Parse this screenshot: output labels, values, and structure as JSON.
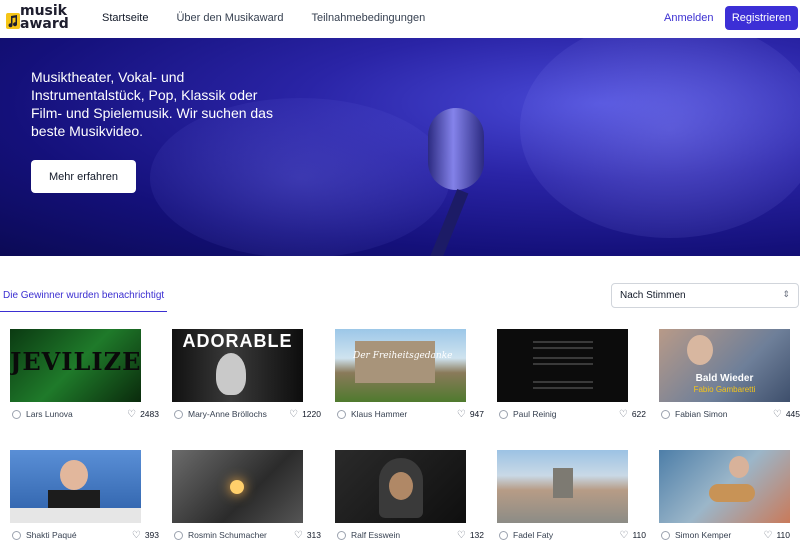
{
  "header": {
    "logo": [
      "musik",
      "award"
    ],
    "nav": [
      "Startseite",
      "Über den Musikaward",
      "Teilnahmebedingungen"
    ],
    "login_label": "Anmelden",
    "register_label": "Registrieren"
  },
  "hero": {
    "text": "Musiktheater, Vokal- und Instrumentalstück, Pop, Klassik oder Film- und Spielemusik. Wir suchen das beste Musikvideo.",
    "button_label": "Mehr erfahren"
  },
  "filter": {
    "winner_text": "Die Gewinner wurden benachrichtigt",
    "sort_value": "Nach Stimmen"
  },
  "entries": [
    {
      "name": "Lars Lunova",
      "votes": "2483",
      "thumb_text": "JEVILIZE]"
    },
    {
      "name": "Mary-Anne Bröllochs",
      "votes": "1220",
      "thumb_text": "ADORABLE"
    },
    {
      "name": "Klaus Hammer",
      "votes": "947",
      "thumb_text": "Der Freiheitsgedanke"
    },
    {
      "name": "Paul Reinig",
      "votes": "622",
      "thumb_text": ""
    },
    {
      "name": "Fabian Simon",
      "votes": "445",
      "thumb_text": "Bald Wieder",
      "thumb_sub": "Fabio Gambaretti"
    },
    {
      "name": "Shakti Paqué",
      "votes": "393",
      "thumb_text": ""
    },
    {
      "name": "Rosmin Schumacher",
      "votes": "313",
      "thumb_text": ""
    },
    {
      "name": "Ralf Esswein",
      "votes": "132",
      "thumb_text": ""
    },
    {
      "name": "Fadel Faty",
      "votes": "110",
      "thumb_text": ""
    },
    {
      "name": "Simon Kemper",
      "votes": "110",
      "thumb_text": ""
    }
  ],
  "colors": {
    "accent": "#3c2fd6",
    "hero": "#1b168f"
  }
}
